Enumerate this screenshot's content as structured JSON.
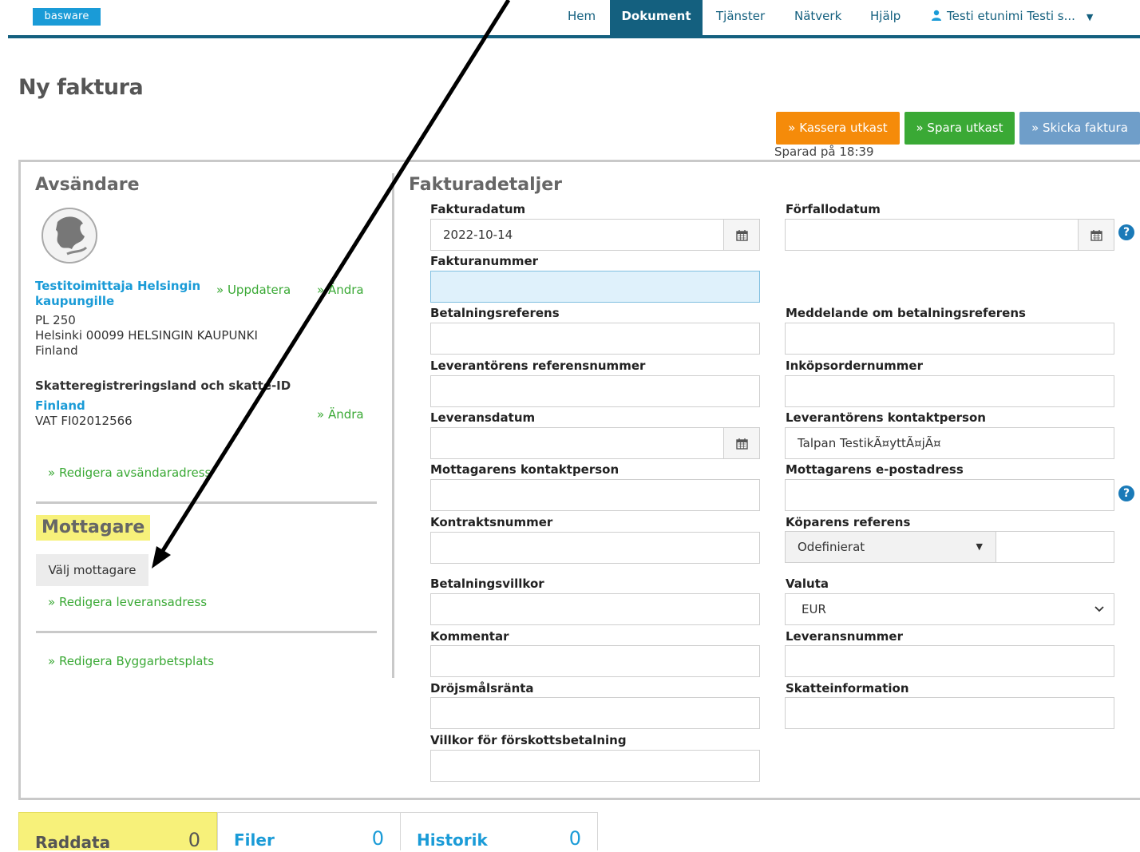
{
  "nav": {
    "logo": "basware",
    "items": [
      "Hem",
      "Dokument",
      "Tjänster",
      "Nätverk",
      "Hjälp"
    ],
    "user": "Testi etunimi Testi s..."
  },
  "page": {
    "title": "Ny faktura",
    "actions": {
      "discard": "» Kassera utkast",
      "save": "» Spara utkast",
      "send": "» Skicka faktura"
    },
    "saved_at": "Sparad på 18:39"
  },
  "sender": {
    "title": "Avsändare",
    "company": "Testitoimittaja Helsingin kaupungille",
    "update": "» Uppdatera",
    "change": "» Ändra",
    "address_line1": "PL 250",
    "address_line2": "Helsinki 00099 HELSINGIN KAUPUNKI",
    "address_line3": "Finland",
    "tax_heading": "Skatteregistreringsland och skatte-ID",
    "tax_country": "Finland",
    "vat": "VAT FI02012566",
    "tax_change": "» Ändra",
    "edit_sender_address": "» Redigera avsändaradress"
  },
  "recipient": {
    "title": "Mottagare",
    "choose": "Välj mottagare",
    "edit_delivery": "» Redigera leveransadress",
    "edit_site": "» Redigera Byggarbetsplats"
  },
  "details": {
    "title": "Fakturadetaljer",
    "invoice_date_label": "Fakturadatum",
    "invoice_date_value": "2022-10-14",
    "due_date_label": "Förfallodatum",
    "invoice_number_label": "Fakturanummer",
    "payment_ref_label": "Betalningsreferens",
    "payment_ref_msg_label": "Meddelande om betalningsreferens",
    "supplier_ref_label": "Leverantörens referensnummer",
    "po_label": "Inköpsordernummer",
    "delivery_date_label": "Leveransdatum",
    "supplier_contact_label": "Leverantörens kontaktperson",
    "supplier_contact_value": "Talpan TestikÃ¤yttÃ¤jÃ¤",
    "recipient_contact_label": "Mottagarens kontaktperson",
    "recipient_email_label": "Mottagarens e-postadress",
    "contract_label": "Kontraktsnummer",
    "buyer_ref_label": "Köparens referens",
    "buyer_ref_value": "Odefinierat",
    "payment_terms_label": "Betalningsvillkor",
    "currency_label": "Valuta",
    "currency_value": "EUR",
    "comment_label": "Kommentar",
    "delivery_number_label": "Leveransnummer",
    "late_interest_label": "Dröjsmålsränta",
    "tax_info_label": "Skatteinformation",
    "prepayment_terms_label": "Villkor för förskottsbetalning"
  },
  "tabs": [
    {
      "label": "Raddata",
      "count": "0"
    },
    {
      "label": "Filer",
      "count": "0"
    },
    {
      "label": "Historik",
      "count": "0"
    }
  ],
  "colors": {
    "brand": "#14607f",
    "link_green": "#3aa935",
    "accent_blue": "#1a9bd7",
    "discard_orange": "#f58b0a",
    "send_blue": "#6f9ec9",
    "highlight_yellow": "#f7f17a"
  }
}
